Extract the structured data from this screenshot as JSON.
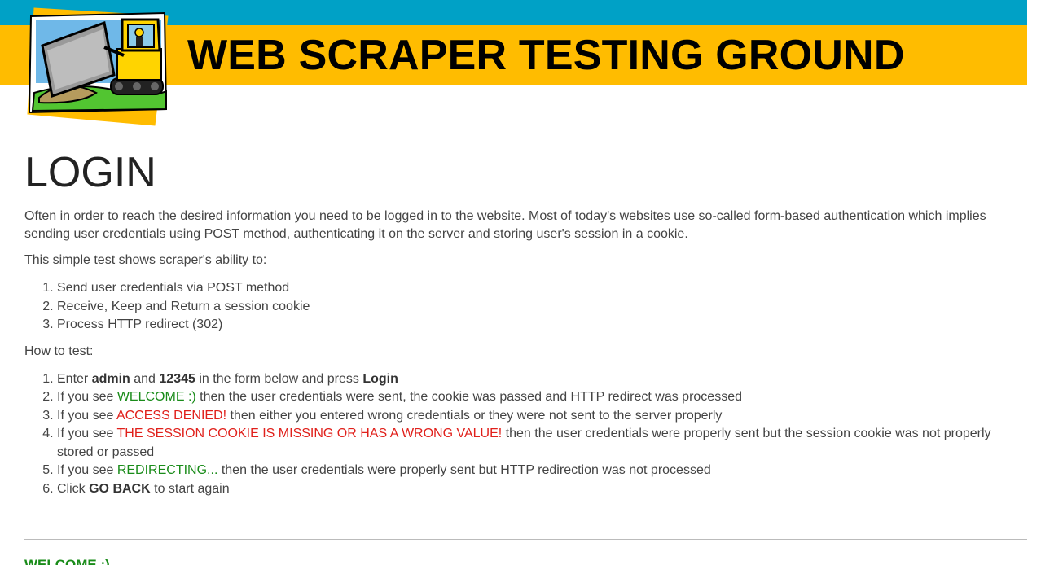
{
  "header": {
    "title": "WEB SCRAPER TESTING GROUND",
    "colors": {
      "top_band": "#00a1c6",
      "title_band": "#ffbc00"
    },
    "logo_icon": "bulldozer-logo-icon"
  },
  "main": {
    "heading": "LOGIN",
    "intro": "Often in order to reach the desired information you need to be logged in to the website. Most of today's websites use so-called form-based authentication which implies sending user credentials using POST method, authenticating it on the server and storing user's session in a cookie.",
    "abilities_intro": "This simple test shows scraper's ability to:",
    "abilities": [
      "Send user credentials via POST method",
      "Receive, Keep and Return a session cookie",
      "Process HTTP redirect (302)"
    ],
    "how_to_intro": "How to test:",
    "steps": {
      "s1": {
        "pre": "Enter ",
        "user": "admin",
        "and": " and ",
        "pass": "12345",
        "mid": " in the form below and press ",
        "btn": "Login"
      },
      "s2": {
        "pre": "If you see ",
        "status": "WELCOME :)",
        "post": " then the user credentials were sent, the cookie was passed and HTTP redirect was processed"
      },
      "s3": {
        "pre": "If you see ",
        "status": "ACCESS DENIED!",
        "post": " then either you entered wrong credentials or they were not sent to the server properly"
      },
      "s4": {
        "pre": "If you see ",
        "status": "THE SESSION COOKIE IS MISSING OR HAS A WRONG VALUE!",
        "post": " then the user credentials were properly sent but the session cookie was not properly stored or passed"
      },
      "s5": {
        "pre": "If you see ",
        "status": "REDIRECTING...",
        "post": " then the user credentials were properly sent but HTTP redirection was not processed"
      },
      "s6": {
        "pre": "Click ",
        "btn": "GO BACK",
        "post": " to start again"
      }
    },
    "status_colors": {
      "success": "#1a8c1a",
      "error": "#e0201b"
    }
  },
  "result": {
    "message": "WELCOME :)"
  }
}
